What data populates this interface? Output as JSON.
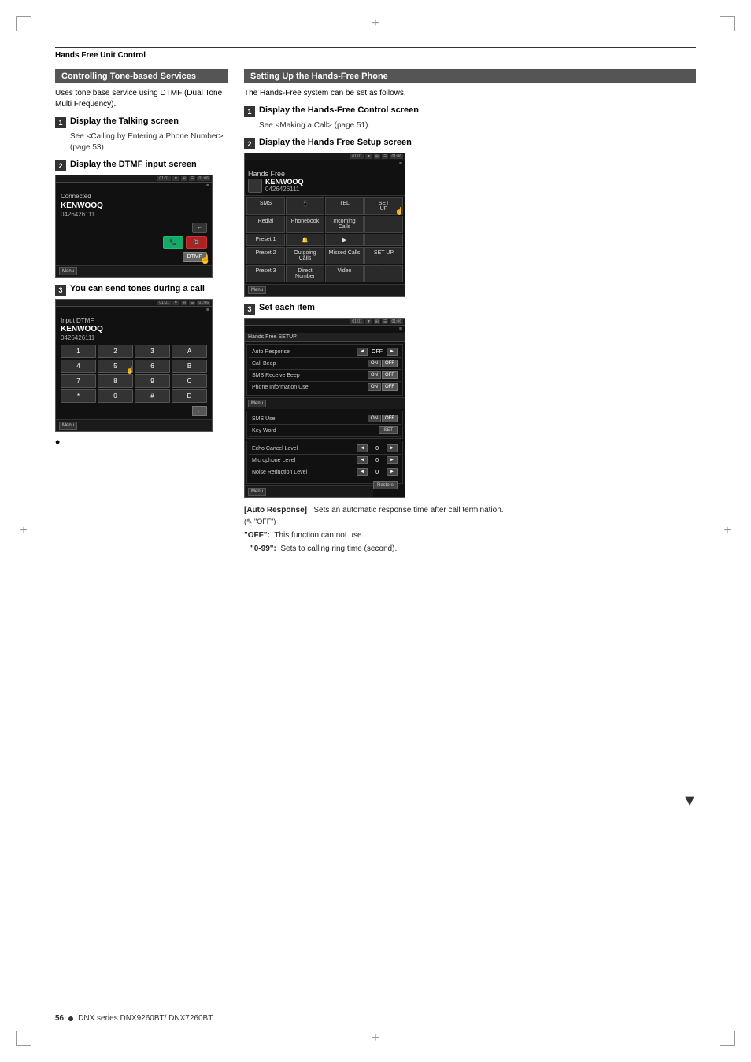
{
  "page": {
    "header": "Hands Free Unit Control",
    "footer_page": "56",
    "footer_series": "DNX series  DNX9260BT/ DNX7260BT"
  },
  "left_section": {
    "title": "Controlling Tone-based Services",
    "intro": "Uses tone base service using DTMF (Dual Tone Multi Frequency).",
    "steps": [
      {
        "num": "1",
        "title": "Display the Talking screen",
        "desc": "See <Calling by Entering a Phone Number> (page 53)."
      },
      {
        "num": "2",
        "title": "Display the DTMF input screen",
        "screen": {
          "status": "01:01  01:06",
          "connected": "Connected",
          "caller": "KENWOOQ",
          "number": "0426426111"
        }
      },
      {
        "num": "3",
        "title": "You can send tones during a call",
        "screen": {
          "label": "Input DTMF",
          "status": "01:01  01:06",
          "caller": "KENWOOQ",
          "number": "0426426111",
          "keys": [
            "1",
            "2",
            "3",
            "A",
            "4",
            "5",
            "6",
            "B",
            "7",
            "8",
            "9",
            "C",
            "*",
            "0",
            "#",
            "D"
          ]
        }
      }
    ]
  },
  "right_section": {
    "title": "Setting Up the Hands-Free Phone",
    "intro": "The Hands-Free system can be set as follows.",
    "steps": [
      {
        "num": "1",
        "title": "Display the Hands-Free Control screen",
        "desc": "See <Making a Call> (page 51)."
      },
      {
        "num": "2",
        "title": "Display the Hands Free Setup screen",
        "screen": {
          "title": "Hands Free",
          "caller": "KENWOOQ",
          "number": "0426426111",
          "grid": [
            "SMS",
            "(phone)",
            "TEL",
            "Redial",
            "Phonebook",
            "Incoming Calls",
            "SETUP",
            "Preset 1",
            "(bell)",
            "(play)",
            "",
            "Preset 2",
            "Outgoing Calls",
            "Missed Calls",
            "SET UP",
            "Preset 3",
            "Direct Number",
            "Video",
            ""
          ]
        }
      },
      {
        "num": "3",
        "title": "Set each item",
        "screen": {
          "title": "Hands Free SETUP",
          "items": [
            {
              "label": "Auto Response",
              "type": "arrow-val",
              "value": "OFF"
            },
            {
              "label": "Call Beep",
              "type": "on-off"
            },
            {
              "label": "SMS Receive Beep",
              "type": "on-off"
            },
            {
              "label": "Phone Information Use",
              "type": "on-off"
            }
          ],
          "items2": [
            {
              "label": "SMS Use",
              "type": "on-off"
            },
            {
              "label": "Key Word",
              "type": "set"
            }
          ],
          "items3": [
            {
              "label": "Echo Cancel Level",
              "type": "arrow-val",
              "value": "0"
            },
            {
              "label": "Microphone Level",
              "type": "arrow-val",
              "value": "0"
            },
            {
              "label": "Noise Reduction Level",
              "type": "arrow-val",
              "value": "0"
            }
          ]
        }
      }
    ],
    "descriptions": [
      {
        "key": "[Auto Response]",
        "text": "Sets an automatic response time after call termination.",
        "note": "(✎ \"OFF\")",
        "items": [
          {
            "key": "\"OFF\":",
            "value": "This function can not use."
          },
          {
            "key": "\"0-99\":",
            "value": "Sets to calling ring time (second)."
          }
        ]
      }
    ]
  }
}
